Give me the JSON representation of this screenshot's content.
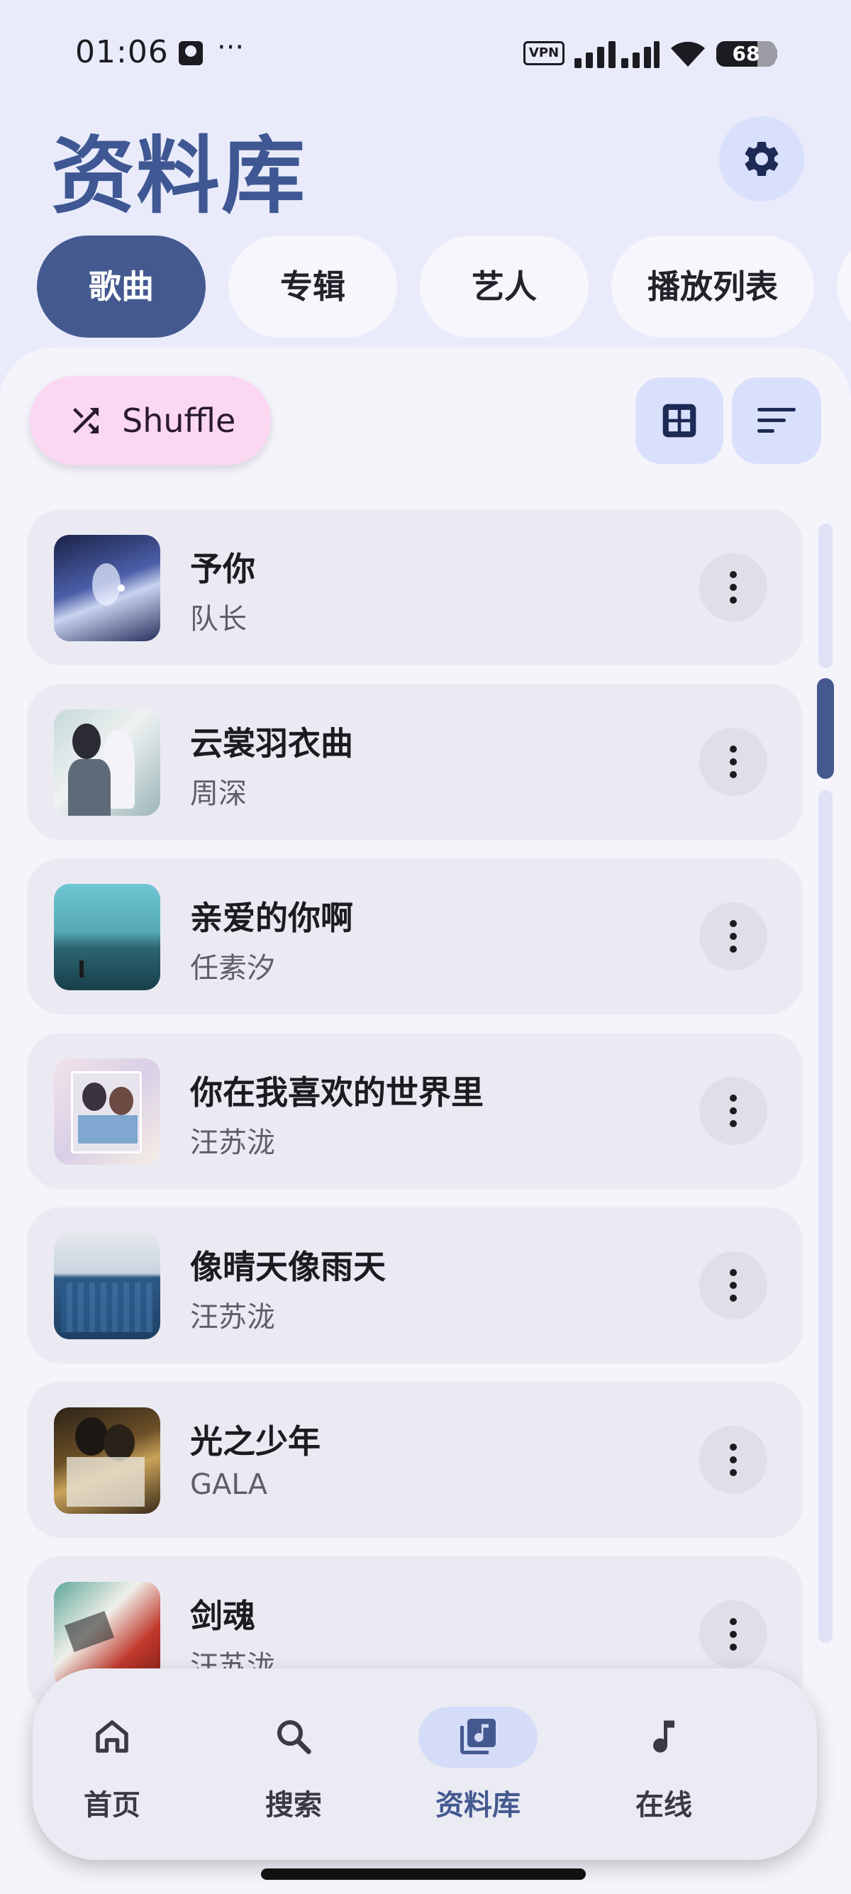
{
  "status_bar": {
    "time": "01:06",
    "dots": "···",
    "vpn": "VPN",
    "battery": "68"
  },
  "header": {
    "title": "资料库",
    "settings_icon": "gear-icon"
  },
  "tabs": [
    {
      "label": "歌曲",
      "active": true
    },
    {
      "label": "专辑",
      "active": false
    },
    {
      "label": "艺人",
      "active": false
    },
    {
      "label": "播放列表",
      "active": false
    }
  ],
  "toolbar": {
    "shuffle_label": "Shuffle",
    "shuffle_icon": "shuffle-icon",
    "grid_icon": "grid-view-icon",
    "sort_icon": "sort-icon"
  },
  "songs": [
    {
      "title": "予你",
      "artist": "队长"
    },
    {
      "title": "云裳羽衣曲",
      "artist": "周深"
    },
    {
      "title": "亲爱的你啊",
      "artist": "任素汐"
    },
    {
      "title": "你在我喜欢的世界里",
      "artist": "汪苏泷"
    },
    {
      "title": "像晴天像雨天",
      "artist": "汪苏泷"
    },
    {
      "title": "光之少年",
      "artist": "GALA"
    },
    {
      "title": "剑魂",
      "artist": "汪苏泷"
    }
  ],
  "bottom_nav": [
    {
      "label": "首页",
      "icon": "home-icon",
      "active": false
    },
    {
      "label": "搜索",
      "icon": "search-icon",
      "active": false
    },
    {
      "label": "资料库",
      "icon": "library-music-icon",
      "active": true
    },
    {
      "label": "在线",
      "icon": "music-note-icon",
      "active": false
    }
  ],
  "colors": {
    "accent": "#44598f",
    "title": "#3f5793",
    "background": "#e9ebfb",
    "shuffle": "#fbd7f2"
  }
}
